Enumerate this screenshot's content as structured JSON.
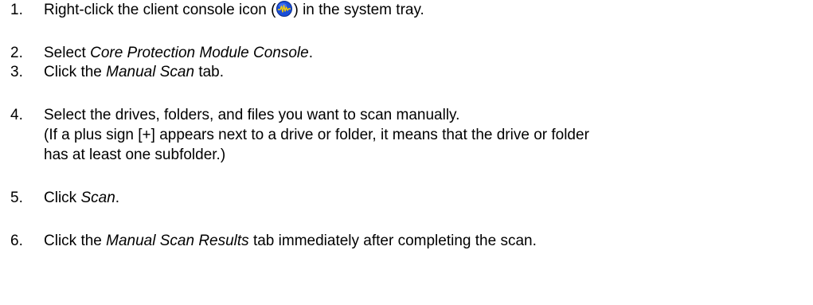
{
  "steps": [
    {
      "number": "1.",
      "pre": "Right-click the client console icon (",
      "icon": "client-console-tray-icon",
      "post": ") in the system tray."
    },
    {
      "number": "2.",
      "pre": "Select ",
      "em": "Core Protection Module Console",
      "post": "."
    },
    {
      "number": "3.",
      "pre": "Click the ",
      "em": "Manual Scan",
      "post": " tab."
    },
    {
      "number": "4.",
      "text": "Select the drives, folders, and files you want to scan manually.",
      "note_line1": "(If a plus sign [+] appears next to a drive or folder, it means that the drive or folder",
      "note_line2": "has at least one subfolder.)"
    },
    {
      "number": "5.",
      "pre": "Click ",
      "em": "Scan",
      "post": "."
    },
    {
      "number": "6.",
      "pre": "Click the ",
      "em": "Manual Scan Results",
      "post": " tab immediately after completing the scan."
    }
  ],
  "colors": {
    "text": "#000000",
    "background": "#ffffff",
    "icon_blue": "#1a4fd8",
    "icon_wave": "#ffd200"
  }
}
